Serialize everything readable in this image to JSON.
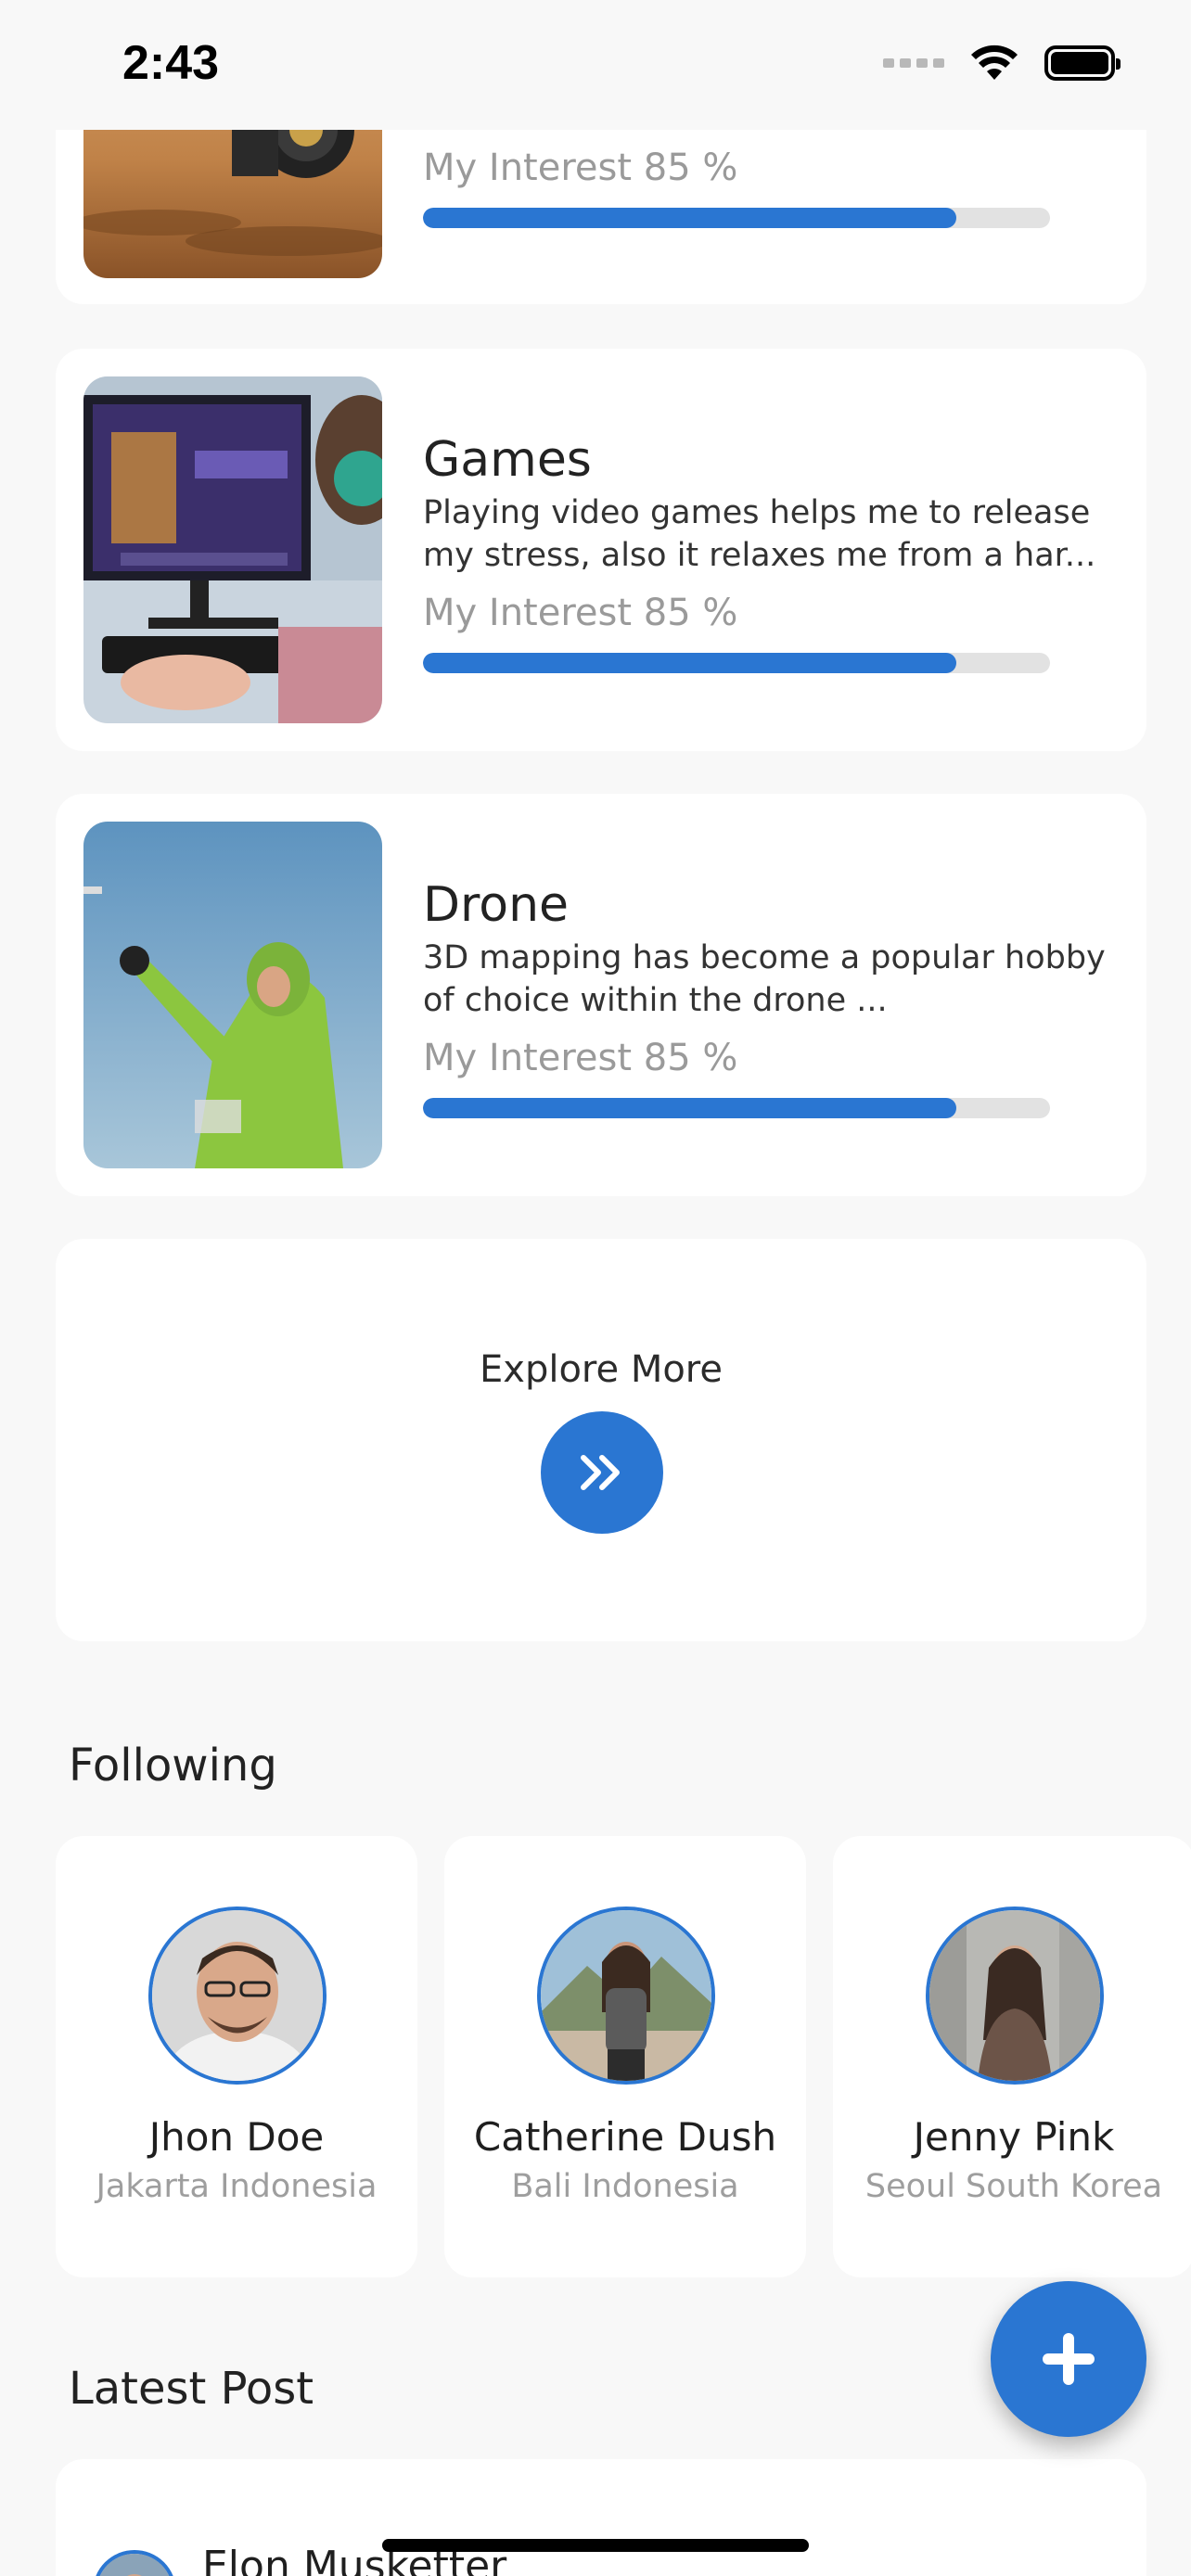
{
  "status_bar": {
    "time": "2:43"
  },
  "interests": [
    {
      "label": "My Interest 85 %",
      "progress": 0.85
    },
    {
      "title": "Games",
      "description": "Playing video games helps me to release my stress, also it relaxes me from a har...",
      "label": "My Interest 85 %",
      "progress": 0.85
    },
    {
      "title": "Drone",
      "description": "3D mapping has become a popular hobby of choice within the drone ...",
      "label": "My Interest 85 %",
      "progress": 0.85
    }
  ],
  "explore": {
    "label": "Explore More"
  },
  "following": {
    "title": "Following",
    "people": [
      {
        "name": "Jhon Doe",
        "location": "Jakarta Indonesia"
      },
      {
        "name": "Catherine Dush",
        "location": "Bali Indonesia"
      },
      {
        "name": "Jenny Pink",
        "location": "Seoul South Korea"
      }
    ]
  },
  "latest_post": {
    "title": "Latest Post",
    "author": "Elon Musketter"
  },
  "colors": {
    "accent": "#2a76d2",
    "progress_track": "#e2e2e2",
    "background": "#f8f8f8"
  },
  "icons": {
    "explore_button": "double-chevron-right-icon",
    "fab": "plus-icon"
  }
}
